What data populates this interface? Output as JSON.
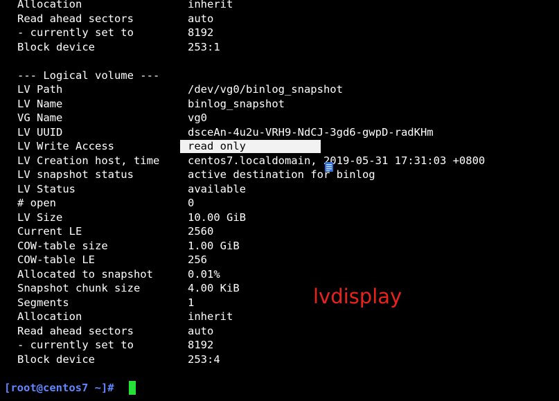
{
  "terminal": {
    "background": "#000000",
    "foreground": "#ffffff",
    "prompt_color": "#5f87ff",
    "cursor_color": "#26e03a",
    "highlight_background": "#f2f2f2",
    "top_rows": [
      {
        "key": "Allocation",
        "value": "inherit"
      },
      {
        "key": "Read ahead sectors",
        "value": "auto"
      },
      {
        "key": "- currently set to",
        "value": "8192"
      },
      {
        "key": "Block device",
        "value": "253:1"
      }
    ],
    "section_header": "--- Logical volume ---",
    "lv_rows": [
      {
        "key": "LV Path",
        "value": "/dev/vg0/binlog_snapshot"
      },
      {
        "key": "LV Name",
        "value": "binlog_snapshot"
      },
      {
        "key": "VG Name",
        "value": "vg0"
      },
      {
        "key": "LV UUID",
        "value": "dsceAn-4u2u-VRH9-NdCJ-3gd6-gwpD-radKHm"
      },
      {
        "key": "LV Write Access",
        "value": "read only"
      },
      {
        "key": "LV Creation host, time",
        "value": "centos7.localdomain, 2019-05-31 17:31:03 +0800"
      },
      {
        "key": "LV snapshot status",
        "value": "active destination for binlog"
      },
      {
        "key": "LV Status",
        "value": "available"
      },
      {
        "key": "# open",
        "value": "0"
      },
      {
        "key": "LV Size",
        "value": "10.00 GiB"
      },
      {
        "key": "Current LE",
        "value": "2560"
      },
      {
        "key": "COW-table size",
        "value": "1.00 GiB"
      },
      {
        "key": "COW-table LE",
        "value": "256"
      },
      {
        "key": "Allocated to snapshot",
        "value": "0.01%"
      },
      {
        "key": "Snapshot chunk size",
        "value": "4.00 KiB"
      },
      {
        "key": "Segments",
        "value": "1"
      },
      {
        "key": "Allocation",
        "value": "inherit"
      },
      {
        "key": "Read ahead sectors",
        "value": "auto"
      },
      {
        "key": "- currently set to",
        "value": "8192"
      },
      {
        "key": "Block device",
        "value": "253:4"
      }
    ],
    "prompt": "[root@centos7 ~]#",
    "annotation": "lvdisplay",
    "annotation_color": "#e8231c",
    "overlay_icon": "document-icon"
  }
}
